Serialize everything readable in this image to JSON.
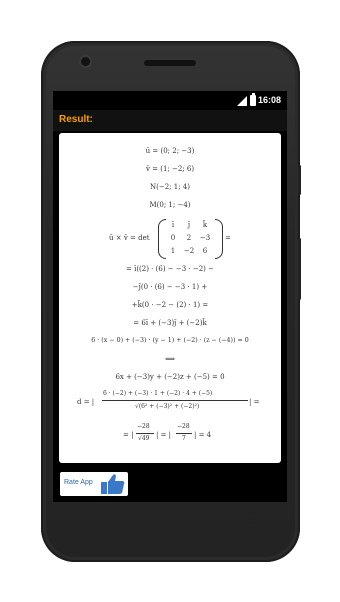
{
  "status": {
    "time": "16:08"
  },
  "app": {
    "title": "Result:"
  },
  "result": {
    "lines": [
      "ū = (0; 2; −3)",
      "v̄ = (1; −2; 6)",
      "N(−2; 1; 4)",
      "M(0; 1; −4)"
    ],
    "cross": {
      "label": "ū × v̄ = det",
      "matrix": [
        [
          "ī",
          "j̄",
          "k̄"
        ],
        [
          "0",
          "2",
          "−3"
        ],
        [
          "1",
          "−2",
          "6"
        ]
      ],
      "suffix": "="
    },
    "steps": [
      "= ī((2) · (6) − −3 · −2) −",
      "−j̄(0 · (6) − −3 · 1) +",
      "+k̄(0 · −2 − (2) · 1) =",
      "= 6ī + (−3)j̄ + (−2)k̄",
      "6 · (x − 0) + (−3) · (y − 1) + (−2) · (z − (−4)) = 0",
      "⟺",
      "6x + (−3)y + (−2)z + (−5) = 0"
    ],
    "distance": {
      "prefix": "d = |",
      "numerator": "6 · (−2) + (−3) · 1 + (−2) · 4 + (−5)",
      "denominator": "√(6² + (−3)² + (−2)²)",
      "suffix": "| ="
    },
    "final": {
      "prefix": "= |",
      "num1": "−28",
      "den1": "√49",
      "mid": "| = |",
      "num2": "−28",
      "den2": "7",
      "suffix": "| = 4"
    }
  },
  "rate": {
    "label": "Rate App"
  },
  "colors": {
    "accent": "#f5a000",
    "link": "#2b6cb0",
    "thumb": "#3a78c9"
  }
}
